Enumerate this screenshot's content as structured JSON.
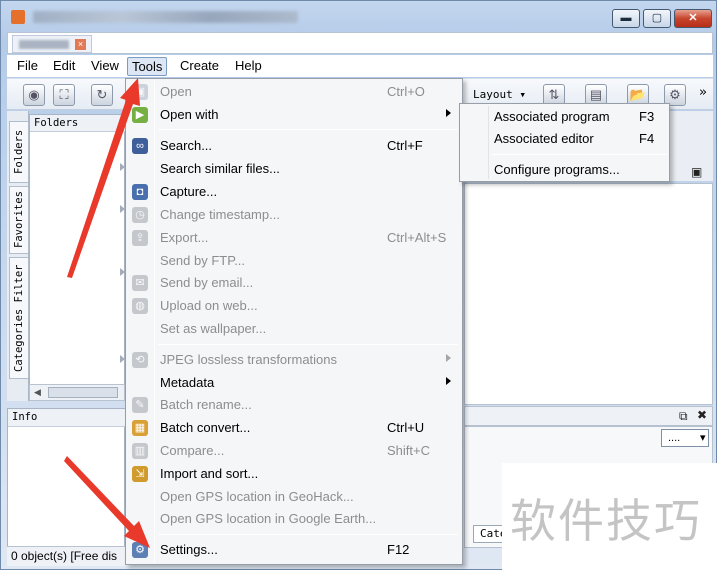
{
  "menubar": {
    "items": [
      "File",
      "Edit",
      "View",
      "Tools",
      "Create",
      "Help"
    ]
  },
  "toolbar": {
    "layout_label": "Layout",
    "more_label": "»"
  },
  "side_tabs": [
    "Folders",
    "Favorites",
    "Categories Filter"
  ],
  "folders_panel": {
    "title": "Folders"
  },
  "info_panel": {
    "title": "Info"
  },
  "status_bar": {
    "text": "0 object(s) [Free dis"
  },
  "right_panel": {
    "dropdown_value": "....",
    "category_tab": "Cate"
  },
  "tools_menu": {
    "items": [
      {
        "label": "Open",
        "shortcut": "Ctrl+O",
        "disabled": true
      },
      {
        "label": "Open with",
        "shortcut": "",
        "disabled": false,
        "submenu": true
      },
      {
        "label": "Search...",
        "shortcut": "Ctrl+F",
        "disabled": false
      },
      {
        "label": "Search similar files...",
        "shortcut": "",
        "disabled": false
      },
      {
        "label": "Capture...",
        "shortcut": "",
        "disabled": false
      },
      {
        "label": "Change timestamp...",
        "shortcut": "",
        "disabled": true
      },
      {
        "label": "Export...",
        "shortcut": "Ctrl+Alt+S",
        "disabled": true
      },
      {
        "label": "Send by FTP...",
        "shortcut": "",
        "disabled": true
      },
      {
        "label": "Send by email...",
        "shortcut": "",
        "disabled": true
      },
      {
        "label": "Upload on web...",
        "shortcut": "",
        "disabled": true
      },
      {
        "label": "Set as wallpaper...",
        "shortcut": "",
        "disabled": true
      },
      {
        "label": "JPEG lossless transformations",
        "shortcut": "",
        "disabled": true,
        "submenu": true
      },
      {
        "label": "Metadata",
        "shortcut": "",
        "disabled": false,
        "submenu": true
      },
      {
        "label": "Batch rename...",
        "shortcut": "",
        "disabled": true
      },
      {
        "label": "Batch convert...",
        "shortcut": "Ctrl+U",
        "disabled": false
      },
      {
        "label": "Compare...",
        "shortcut": "Shift+C",
        "disabled": true
      },
      {
        "label": "Import and sort...",
        "shortcut": "",
        "disabled": false
      },
      {
        "label": "Open GPS location in GeoHack...",
        "shortcut": "",
        "disabled": true
      },
      {
        "label": "Open GPS location in Google Earth...",
        "shortcut": "",
        "disabled": true
      },
      {
        "label": "Settings...",
        "shortcut": "F12",
        "disabled": false
      }
    ]
  },
  "open_with_submenu": {
    "items": [
      {
        "label": "Associated program",
        "shortcut": "F3"
      },
      {
        "label": "Associated editor",
        "shortcut": "F4"
      },
      {
        "label": "Configure programs...",
        "shortcut": ""
      }
    ]
  },
  "watermark": {
    "text": "软件技巧"
  },
  "colors": {
    "annotation_arrow": "#e8392b",
    "menu_background": "#f5f6f8",
    "disabled_text": "#8d8d8d"
  }
}
